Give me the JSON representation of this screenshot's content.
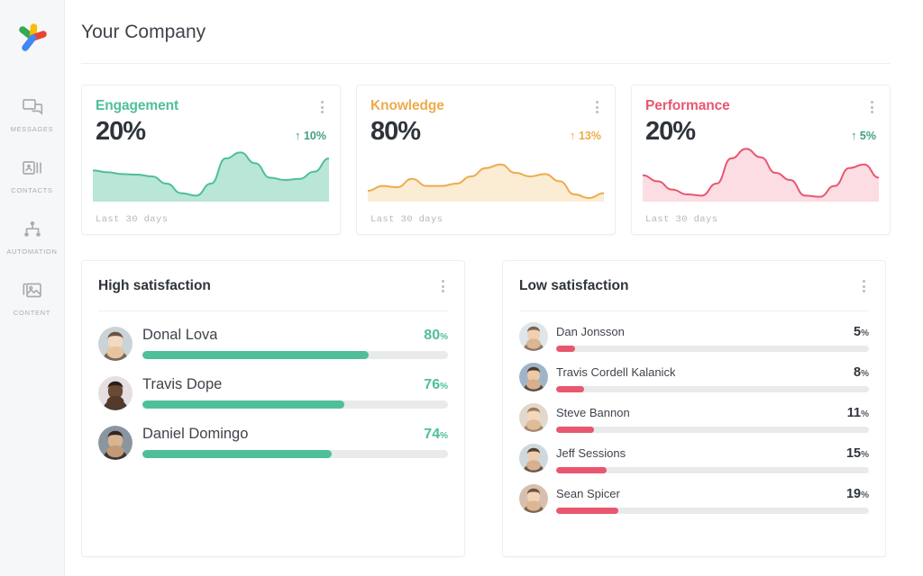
{
  "sidebar": {
    "logo_name": "pinwheel-logo",
    "logo_colors": [
      "#34a853",
      "#fbbc04",
      "#ea4335",
      "#4285f4"
    ],
    "items": [
      {
        "label": "MESSAGES",
        "icon": "chat-bubbles-icon"
      },
      {
        "label": "CONTACTS",
        "icon": "contact-card-icon"
      },
      {
        "label": "AUTOMATION",
        "icon": "node-tree-icon"
      },
      {
        "label": "CONTENT",
        "icon": "image-stack-icon"
      }
    ]
  },
  "header": {
    "title": "Your Company"
  },
  "metrics": [
    {
      "title": "Engagement",
      "value": "20%",
      "delta": "10%",
      "delta_arrow": "↑",
      "footer": "Last 30 days",
      "color": "#4fbf9a",
      "fill": "#b9e6d6",
      "delta_color": "#41a07b",
      "menu": "more-options-icon"
    },
    {
      "title": "Knowledge",
      "value": "80%",
      "delta": "13%",
      "delta_arrow": "↑",
      "footer": "Last 30 days",
      "color": "#eeab4c",
      "fill": "#fbecd4",
      "delta_color": "#eeab4c",
      "menu": "more-options-icon"
    },
    {
      "title": "Performance",
      "value": "20%",
      "delta": "5%",
      "delta_arrow": "↑",
      "footer": "Last 30 days",
      "color": "#e8576f",
      "fill": "#fbdde3",
      "delta_color": "#41a07b",
      "menu": "more-options-icon"
    }
  ],
  "chart_data": [
    {
      "type": "area",
      "title": "Engagement",
      "name": "engagement-sparkline",
      "xlabel": "",
      "ylabel": "",
      "x": [
        0,
        1,
        2,
        3,
        4,
        5,
        6,
        7,
        8,
        9,
        10,
        11,
        12,
        13,
        14,
        15,
        16
      ],
      "values": [
        52,
        49,
        46,
        45,
        42,
        30,
        14,
        10,
        30,
        72,
        82,
        64,
        40,
        36,
        38,
        50,
        72
      ],
      "ylim": [
        0,
        100
      ],
      "grid": false,
      "legend": "none"
    },
    {
      "type": "area",
      "title": "Knowledge",
      "name": "knowledge-sparkline",
      "xlabel": "",
      "ylabel": "",
      "x": [
        0,
        1,
        2,
        3,
        4,
        5,
        6,
        7,
        8,
        9,
        10,
        11,
        12,
        13,
        14,
        15,
        16
      ],
      "values": [
        18,
        26,
        24,
        38,
        26,
        26,
        30,
        42,
        56,
        62,
        48,
        42,
        46,
        34,
        12,
        6,
        14
      ],
      "ylim": [
        0,
        100
      ],
      "grid": false,
      "legend": "none"
    },
    {
      "type": "area",
      "title": "Performance",
      "name": "performance-sparkline",
      "xlabel": "",
      "ylabel": "",
      "x": [
        0,
        1,
        2,
        3,
        4,
        5,
        6,
        7,
        8,
        9,
        10,
        11,
        12,
        13,
        14,
        15,
        16
      ],
      "values": [
        44,
        34,
        20,
        12,
        10,
        30,
        72,
        88,
        74,
        48,
        36,
        10,
        8,
        26,
        56,
        62,
        40
      ],
      "ylim": [
        0,
        100
      ],
      "grid": false,
      "legend": "none"
    }
  ],
  "high_satisfaction": {
    "title": "High satisfaction",
    "menu": "more-options-icon",
    "accent": "#4fbf9a",
    "rows": [
      {
        "name": "Donal Lova",
        "value": "80",
        "unit": "%",
        "bar": 74,
        "avatar": "avatar-donal-lova"
      },
      {
        "name": "Travis Dope",
        "value": "76",
        "unit": "%",
        "bar": 66,
        "avatar": "avatar-travis-dope"
      },
      {
        "name": "Daniel Domingo",
        "value": "74",
        "unit": "%",
        "bar": 62,
        "avatar": "avatar-daniel-domingo"
      }
    ]
  },
  "low_satisfaction": {
    "title": "Low satisfaction",
    "menu": "more-options-icon",
    "accent": "#e8576f",
    "rows": [
      {
        "name": "Dan Jonsson",
        "value": "5",
        "unit": "%",
        "bar": 6,
        "avatar": "avatar-dan-jonsson"
      },
      {
        "name": "Travis Cordell Kalanick",
        "value": "8",
        "unit": "%",
        "bar": 9,
        "avatar": "avatar-travis-cordell-kalanick"
      },
      {
        "name": "Steve Bannon",
        "value": "11",
        "unit": "%",
        "bar": 12,
        "avatar": "avatar-steve-bannon"
      },
      {
        "name": "Jeff Sessions",
        "value": "15",
        "unit": "%",
        "bar": 16,
        "avatar": "avatar-jeff-sessions"
      },
      {
        "name": "Sean Spicer",
        "value": "19",
        "unit": "%",
        "bar": 20,
        "avatar": "avatar-sean-spicer"
      }
    ]
  }
}
